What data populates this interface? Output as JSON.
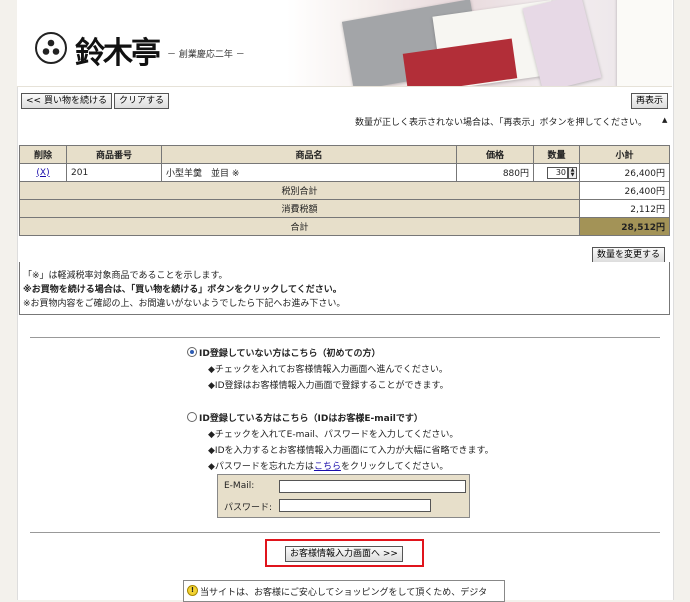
{
  "header": {
    "brand_name": "鈴木亭",
    "tagline": "－ 創業慶応二年 －"
  },
  "toolbar": {
    "continue_label": "<< 買い物を続ける",
    "clear_label": "クリアする",
    "refresh_label": "再表示"
  },
  "notice": "数量が正しく表示されない場合は、「再表示」ボタンを押してください。",
  "cart": {
    "headers": [
      "削除",
      "商品番号",
      "商品名",
      "価格",
      "数量",
      "小計"
    ],
    "row": {
      "delete": "(X)",
      "item_no": "201",
      "name": "小型羊羹　並目 ※",
      "price": "880円",
      "qty": "30",
      "subtotal": "26,400円"
    },
    "tax_total_label": "税別合計",
    "tax_total_value": "26,400円",
    "tax_label": "消費税額",
    "tax_value": "2,112円",
    "total_label": "合計",
    "total_value": "28,512円",
    "change_qty_label": "数量を変更する"
  },
  "notes": {
    "line1": "「※」は軽減税率対象商品であることを示します。",
    "line2": "※お買物を続ける場合は、「買い物を続ける」ボタンをクリックしてください。",
    "line3": "※お買物内容をご確認の上、お間違いがないようでしたら下記へお進み下さい。"
  },
  "options": {
    "new_label": "ID登録していない方はこちら（初めての方）",
    "new_sub1": "◆チェックを入れてお客様情報入力画面へ進んでください。",
    "new_sub2": "◆ID登録はお客様情報入力画面で登録することができます。",
    "member_label": "ID登録している方はこちら（IDはお客様E-mailです）",
    "member_sub1": "◆チェックを入れてE-mail、パスワードを入力してください。",
    "member_sub2": "◆IDを入力するとお客様情報入力画面にて入力が大幅に省略できます。",
    "member_sub3_pre": "◆パスワードを忘れた方は",
    "member_sub3_link": "こちら",
    "member_sub3_post": "をクリックしてください。",
    "email_label": "E-Mail:",
    "password_label": "パスワード:",
    "email_value": "",
    "password_value": ""
  },
  "proceed_label": "お客様情報入力画面へ >>",
  "info_text": "当サイトは、お客様にご安心してショッピングをして頂くため、デジタ",
  "colors": {
    "header_beige": "#e7dfca",
    "total_gold": "#a39357",
    "highlight_red": "#e0141c",
    "link_blue": "#1a0dab"
  }
}
